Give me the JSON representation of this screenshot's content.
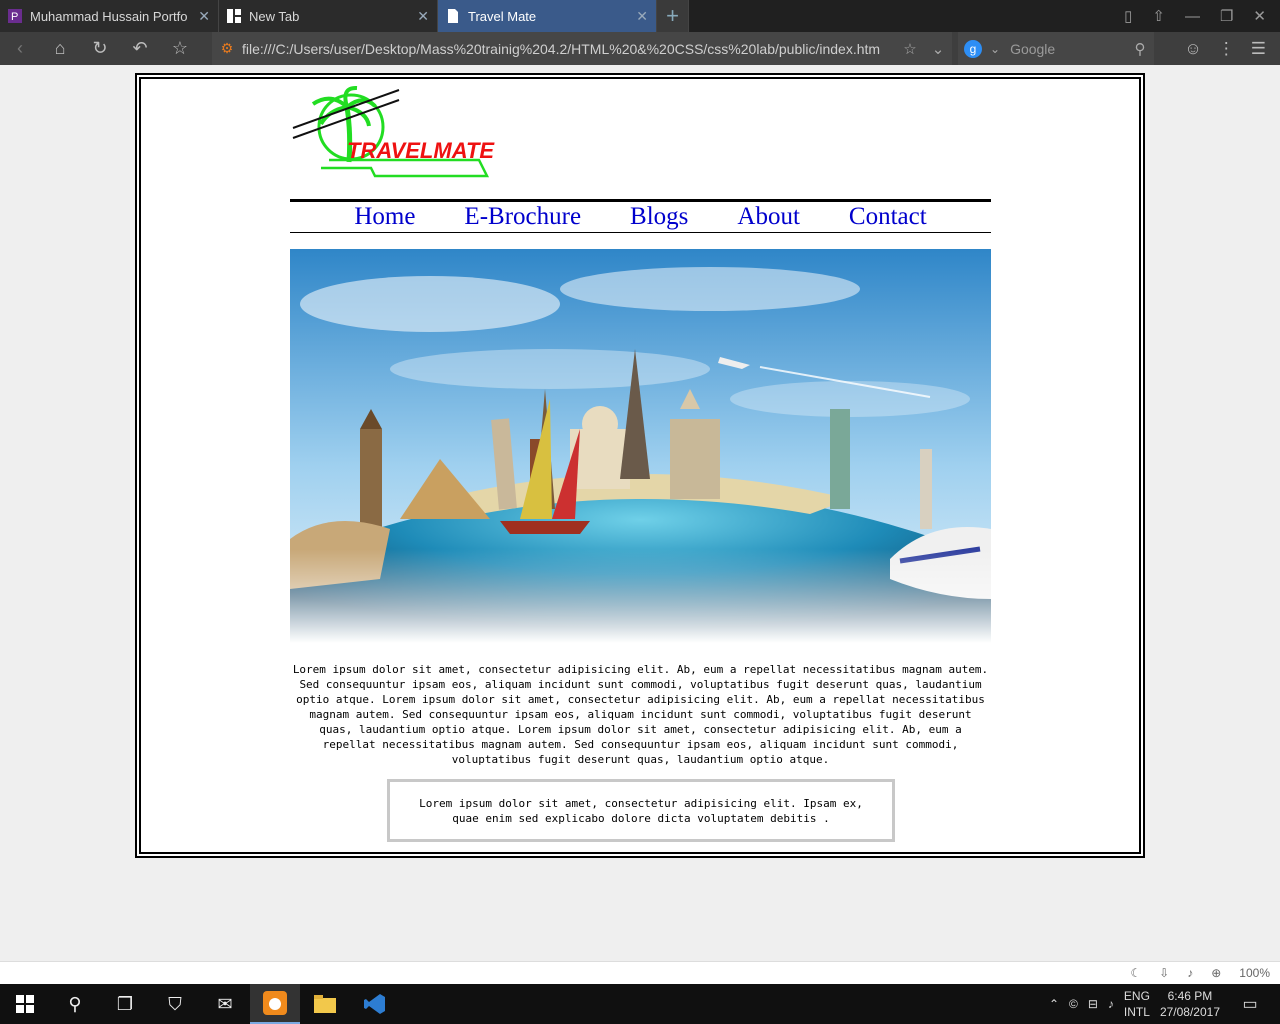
{
  "browser": {
    "tabs": [
      {
        "title": "Muhammad Hussain Portfo",
        "favicon": "purple-p-icon",
        "active": false
      },
      {
        "title": "New Tab",
        "favicon": "grid-icon",
        "active": false
      },
      {
        "title": "Travel Mate",
        "favicon": "page-icon",
        "active": true
      }
    ],
    "new_tab_glyph": "+",
    "url": "file:///C:/Users/user/Desktop/Mass%20trainig%204.2/HTML%20&%20CSS/css%20lab/public/index.htm",
    "search_placeholder": "Google",
    "search_engine_glyph": "g"
  },
  "page": {
    "logo_text": "TRAVELMATE",
    "menu": [
      "Home",
      "E-Brochure",
      "Blogs",
      "About",
      "Contact"
    ],
    "paragraph": "Lorem ipsum dolor sit amet, consectetur adipisicing elit. Ab, eum a repellat necessitatibus magnam autem. Sed consequuntur ipsam eos, aliquam incidunt sunt commodi, voluptatibus fugit deserunt quas, laudantium optio atque. Lorem ipsum dolor sit amet, consectetur adipisicing elit. Ab, eum a repellat necessitatibus magnam autem. Sed consequuntur ipsam eos, aliquam incidunt sunt commodi, voluptatibus fugit deserunt quas, laudantium optio atque. Lorem ipsum dolor sit amet, consectetur adipisicing elit. Ab, eum a repellat necessitatibus magnam autem. Sed consequuntur ipsam eos, aliquam incidunt sunt commodi, voluptatibus fugit deserunt quas, laudantium optio atque.",
    "box_text": "Lorem ipsum dolor sit amet, consectetur adipisicing elit. Ipsam ex, quae enim sed explicabo dolore dicta voluptatem debitis ."
  },
  "statusbar": {
    "zoom": "100%"
  },
  "taskbar": {
    "lang_line1": "ENG",
    "lang_line2": "INTL",
    "time": "6:46 PM",
    "date": "27/08/2017"
  },
  "colors": {
    "link": "#0000cc",
    "logo_green": "#22dd22",
    "logo_red": "#ee1111"
  }
}
